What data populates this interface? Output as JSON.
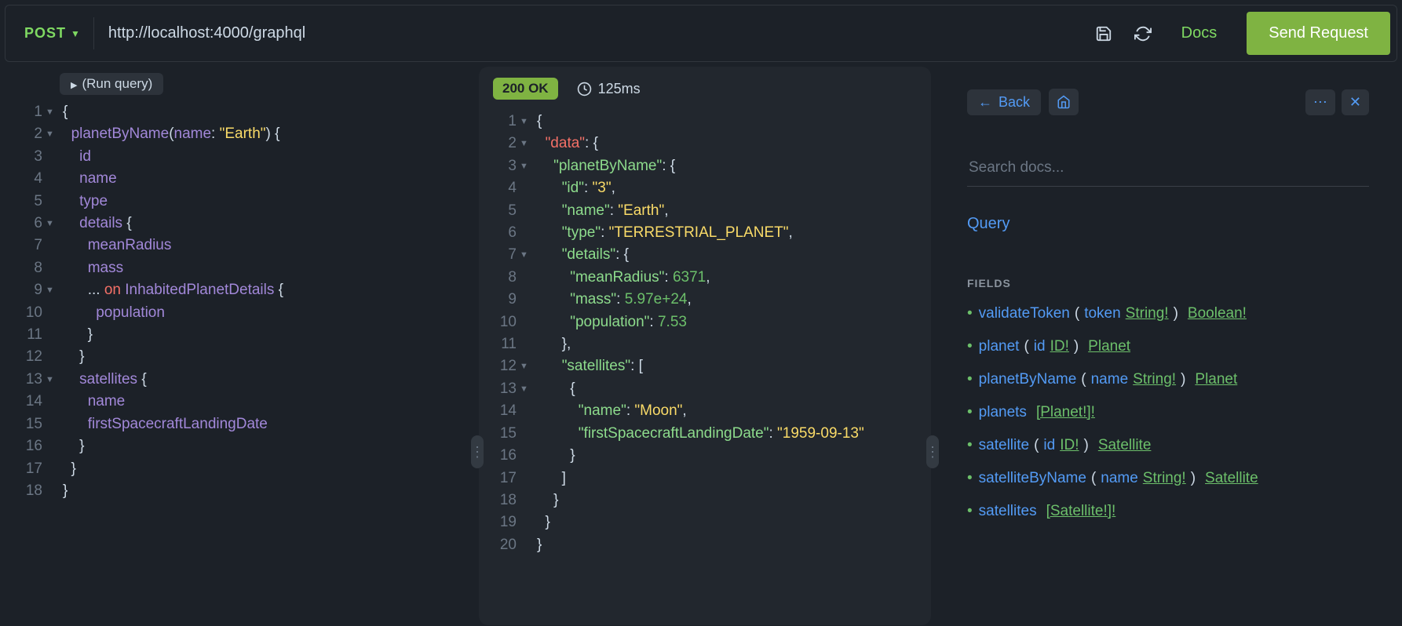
{
  "header": {
    "method": "POST",
    "url": "http://localhost:4000/graphql",
    "docs_label": "Docs",
    "send_label": "Send Request"
  },
  "query": {
    "run_label": "(Run query)",
    "lines": [
      {
        "n": 1,
        "fold": true,
        "segs": [
          {
            "t": "{",
            "c": "punc"
          }
        ]
      },
      {
        "n": 2,
        "fold": true,
        "segs": [
          {
            "t": "  ",
            "c": "punc"
          },
          {
            "t": "planetByName",
            "c": "pn"
          },
          {
            "t": "(",
            "c": "punc"
          },
          {
            "t": "name",
            "c": "pn"
          },
          {
            "t": ": ",
            "c": "punc"
          },
          {
            "t": "\"Earth\"",
            "c": "str"
          },
          {
            "t": ") {",
            "c": "punc"
          }
        ]
      },
      {
        "n": 3,
        "fold": false,
        "segs": [
          {
            "t": "    ",
            "c": "punc"
          },
          {
            "t": "id",
            "c": "pn"
          }
        ]
      },
      {
        "n": 4,
        "fold": false,
        "segs": [
          {
            "t": "    ",
            "c": "punc"
          },
          {
            "t": "name",
            "c": "pn"
          }
        ]
      },
      {
        "n": 5,
        "fold": false,
        "segs": [
          {
            "t": "    ",
            "c": "punc"
          },
          {
            "t": "type",
            "c": "pn"
          }
        ]
      },
      {
        "n": 6,
        "fold": true,
        "segs": [
          {
            "t": "    ",
            "c": "punc"
          },
          {
            "t": "details",
            "c": "pn"
          },
          {
            "t": " {",
            "c": "punc"
          }
        ]
      },
      {
        "n": 7,
        "fold": false,
        "segs": [
          {
            "t": "      ",
            "c": "punc"
          },
          {
            "t": "meanRadius",
            "c": "pn"
          }
        ]
      },
      {
        "n": 8,
        "fold": false,
        "segs": [
          {
            "t": "      ",
            "c": "punc"
          },
          {
            "t": "mass",
            "c": "pn"
          }
        ]
      },
      {
        "n": 9,
        "fold": true,
        "segs": [
          {
            "t": "      ",
            "c": "punc"
          },
          {
            "t": "... ",
            "c": "punc"
          },
          {
            "t": "on",
            "c": "kw"
          },
          {
            "t": " ",
            "c": "punc"
          },
          {
            "t": "InhabitedPlanetDetails",
            "c": "pn"
          },
          {
            "t": " {",
            "c": "punc"
          }
        ]
      },
      {
        "n": 10,
        "fold": false,
        "segs": [
          {
            "t": "        ",
            "c": "punc"
          },
          {
            "t": "population",
            "c": "pn"
          }
        ]
      },
      {
        "n": 11,
        "fold": false,
        "segs": [
          {
            "t": "      }",
            "c": "punc"
          }
        ]
      },
      {
        "n": 12,
        "fold": false,
        "segs": [
          {
            "t": "    }",
            "c": "punc"
          }
        ]
      },
      {
        "n": 13,
        "fold": true,
        "segs": [
          {
            "t": "    ",
            "c": "punc"
          },
          {
            "t": "satellites",
            "c": "pn"
          },
          {
            "t": " {",
            "c": "punc"
          }
        ]
      },
      {
        "n": 14,
        "fold": false,
        "segs": [
          {
            "t": "      ",
            "c": "punc"
          },
          {
            "t": "name",
            "c": "pn"
          }
        ]
      },
      {
        "n": 15,
        "fold": false,
        "segs": [
          {
            "t": "      ",
            "c": "punc"
          },
          {
            "t": "firstSpacecraftLandingDate",
            "c": "pn"
          }
        ]
      },
      {
        "n": 16,
        "fold": false,
        "segs": [
          {
            "t": "    }",
            "c": "punc"
          }
        ]
      },
      {
        "n": 17,
        "fold": false,
        "segs": [
          {
            "t": "  }",
            "c": "punc"
          }
        ]
      },
      {
        "n": 18,
        "fold": false,
        "segs": [
          {
            "t": "}",
            "c": "punc"
          }
        ]
      }
    ]
  },
  "result": {
    "status": "200 OK",
    "latency": "125ms",
    "lines": [
      {
        "n": 1,
        "fold": true,
        "segs": [
          {
            "t": "{",
            "c": "punc"
          }
        ]
      },
      {
        "n": 2,
        "fold": true,
        "segs": [
          {
            "t": "  ",
            "c": "punc"
          },
          {
            "t": "\"data\"",
            "c": "kw"
          },
          {
            "t": ": {",
            "c": "punc"
          }
        ]
      },
      {
        "n": 3,
        "fold": true,
        "segs": [
          {
            "t": "    ",
            "c": "punc"
          },
          {
            "t": "\"planetByName\"",
            "c": "key"
          },
          {
            "t": ": {",
            "c": "punc"
          }
        ]
      },
      {
        "n": 4,
        "fold": false,
        "segs": [
          {
            "t": "      ",
            "c": "punc"
          },
          {
            "t": "\"id\"",
            "c": "key"
          },
          {
            "t": ": ",
            "c": "punc"
          },
          {
            "t": "\"3\"",
            "c": "str"
          },
          {
            "t": ",",
            "c": "punc"
          }
        ]
      },
      {
        "n": 5,
        "fold": false,
        "segs": [
          {
            "t": "      ",
            "c": "punc"
          },
          {
            "t": "\"name\"",
            "c": "key"
          },
          {
            "t": ": ",
            "c": "punc"
          },
          {
            "t": "\"Earth\"",
            "c": "str"
          },
          {
            "t": ",",
            "c": "punc"
          }
        ]
      },
      {
        "n": 6,
        "fold": false,
        "segs": [
          {
            "t": "      ",
            "c": "punc"
          },
          {
            "t": "\"type\"",
            "c": "key"
          },
          {
            "t": ": ",
            "c": "punc"
          },
          {
            "t": "\"TERRESTRIAL_PLANET\"",
            "c": "str"
          },
          {
            "t": ",",
            "c": "punc"
          }
        ]
      },
      {
        "n": 7,
        "fold": true,
        "segs": [
          {
            "t": "      ",
            "c": "punc"
          },
          {
            "t": "\"details\"",
            "c": "key"
          },
          {
            "t": ": {",
            "c": "punc"
          }
        ]
      },
      {
        "n": 8,
        "fold": false,
        "segs": [
          {
            "t": "        ",
            "c": "punc"
          },
          {
            "t": "\"meanRadius\"",
            "c": "key"
          },
          {
            "t": ": ",
            "c": "punc"
          },
          {
            "t": "6371",
            "c": "num"
          },
          {
            "t": ",",
            "c": "punc"
          }
        ]
      },
      {
        "n": 9,
        "fold": false,
        "segs": [
          {
            "t": "        ",
            "c": "punc"
          },
          {
            "t": "\"mass\"",
            "c": "key"
          },
          {
            "t": ": ",
            "c": "punc"
          },
          {
            "t": "5.97e+24",
            "c": "num"
          },
          {
            "t": ",",
            "c": "punc"
          }
        ]
      },
      {
        "n": 10,
        "fold": false,
        "segs": [
          {
            "t": "        ",
            "c": "punc"
          },
          {
            "t": "\"population\"",
            "c": "key"
          },
          {
            "t": ": ",
            "c": "punc"
          },
          {
            "t": "7.53",
            "c": "num"
          }
        ]
      },
      {
        "n": 11,
        "fold": false,
        "segs": [
          {
            "t": "      },",
            "c": "punc"
          }
        ]
      },
      {
        "n": 12,
        "fold": true,
        "segs": [
          {
            "t": "      ",
            "c": "punc"
          },
          {
            "t": "\"satellites\"",
            "c": "key"
          },
          {
            "t": ": [",
            "c": "punc"
          }
        ]
      },
      {
        "n": 13,
        "fold": true,
        "segs": [
          {
            "t": "        {",
            "c": "punc"
          }
        ]
      },
      {
        "n": 14,
        "fold": false,
        "segs": [
          {
            "t": "          ",
            "c": "punc"
          },
          {
            "t": "\"name\"",
            "c": "key"
          },
          {
            "t": ": ",
            "c": "punc"
          },
          {
            "t": "\"Moon\"",
            "c": "str"
          },
          {
            "t": ",",
            "c": "punc"
          }
        ]
      },
      {
        "n": 15,
        "fold": false,
        "segs": [
          {
            "t": "          ",
            "c": "punc"
          },
          {
            "t": "\"firstSpacecraftLandingDate\"",
            "c": "key"
          },
          {
            "t": ": ",
            "c": "punc"
          },
          {
            "t": "\"1959-09-13\"",
            "c": "str"
          }
        ]
      },
      {
        "n": 16,
        "fold": false,
        "segs": [
          {
            "t": "        }",
            "c": "punc"
          }
        ]
      },
      {
        "n": 17,
        "fold": false,
        "segs": [
          {
            "t": "      ]",
            "c": "punc"
          }
        ]
      },
      {
        "n": 18,
        "fold": false,
        "segs": [
          {
            "t": "    }",
            "c": "punc"
          }
        ]
      },
      {
        "n": 19,
        "fold": false,
        "segs": [
          {
            "t": "  }",
            "c": "punc"
          }
        ]
      },
      {
        "n": 20,
        "fold": false,
        "segs": [
          {
            "t": "}",
            "c": "punc"
          }
        ]
      }
    ]
  },
  "docs": {
    "back_label": "Back",
    "search_placeholder": "Search docs...",
    "root_type": "Query",
    "fields_header": "FIELDS",
    "fields": [
      {
        "name": "validateToken",
        "args": [
          {
            "name": "token",
            "type": "String!"
          }
        ],
        "ret": "Boolean!"
      },
      {
        "name": "planet",
        "args": [
          {
            "name": "id",
            "type": "ID!"
          }
        ],
        "ret": "Planet"
      },
      {
        "name": "planetByName",
        "args": [
          {
            "name": "name",
            "type": "String!"
          }
        ],
        "ret": "Planet"
      },
      {
        "name": "planets",
        "args": [],
        "ret": "[Planet!]!"
      },
      {
        "name": "satellite",
        "args": [
          {
            "name": "id",
            "type": "ID!"
          }
        ],
        "ret": "Satellite"
      },
      {
        "name": "satelliteByName",
        "args": [
          {
            "name": "name",
            "type": "String!"
          }
        ],
        "ret": "Satellite"
      },
      {
        "name": "satellites",
        "args": [],
        "ret": "[Satellite!]!"
      }
    ]
  }
}
